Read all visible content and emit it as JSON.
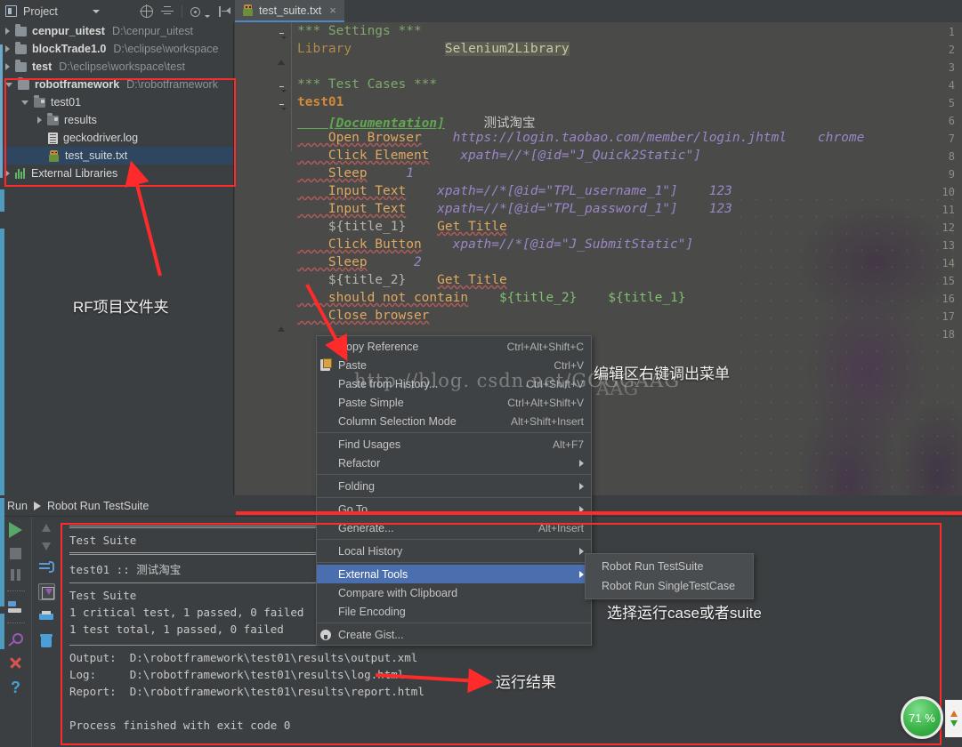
{
  "window": {
    "project_panel_title": "Project"
  },
  "toolbar": {
    "icons": [
      "locate-target-icon",
      "collapse-all-icon",
      "settings-gear-icon",
      "hide-panel-icon"
    ]
  },
  "tabs": [
    {
      "label": "test_suite.txt",
      "icon": "robot-file-icon",
      "close": "×",
      "active": true
    }
  ],
  "tree": {
    "items": [
      {
        "name": "cenpur_uitest",
        "path": "D:\\cenpur_uitest",
        "indent": 0,
        "arrow": "closed",
        "icon": "folder-icon",
        "bold": true
      },
      {
        "name": "blockTrade1.0",
        "path": "D:\\eclipse\\workspace",
        "indent": 0,
        "arrow": "closed",
        "icon": "folder-icon",
        "bold": true
      },
      {
        "name": "test",
        "path": "D:\\eclipse\\workspace\\test",
        "indent": 0,
        "arrow": "closed",
        "icon": "folder-icon",
        "bold": true
      },
      {
        "name": "robotframework",
        "path": "D:\\robotframework",
        "indent": 0,
        "arrow": "open",
        "icon": "folder-icon",
        "bold": true
      },
      {
        "name": "test01",
        "path": "",
        "indent": 1,
        "arrow": "open",
        "icon": "module-folder-icon",
        "bold": false
      },
      {
        "name": "results",
        "path": "",
        "indent": 2,
        "arrow": "closed",
        "icon": "module-folder-icon",
        "bold": false
      },
      {
        "name": "geckodriver.log",
        "path": "",
        "indent": 2,
        "arrow": "none",
        "icon": "log-file-icon",
        "bold": false
      },
      {
        "name": "test_suite.txt",
        "path": "",
        "indent": 2,
        "arrow": "none",
        "icon": "robot-file-icon",
        "bold": false,
        "selected": true
      },
      {
        "name": "External Libraries",
        "path": "",
        "indent": 0,
        "arrow": "closed",
        "icon": "libraries-icon",
        "bold": false
      }
    ]
  },
  "editor": {
    "lines": [
      {
        "n": 1,
        "fold": "minus",
        "segments": [
          {
            "t": "*** Settings ***",
            "c": "c-sec"
          }
        ]
      },
      {
        "n": 2,
        "fold": "up",
        "segments": [
          {
            "t": "Library",
            "c": "c-set"
          },
          {
            "t": "            ",
            "c": "c-plain"
          },
          {
            "t": "Selenium2Library",
            "c": "c-val"
          }
        ]
      },
      {
        "n": 3,
        "fold": "",
        "segments": []
      },
      {
        "n": 4,
        "fold": "minus",
        "segments": [
          {
            "t": "*** Test Cases ***",
            "c": "c-sec"
          }
        ]
      },
      {
        "n": 5,
        "fold": "minus",
        "segments": [
          {
            "t": "test01",
            "c": "c-case"
          }
        ]
      },
      {
        "n": 6,
        "fold": "",
        "segments": [
          {
            "t": "    [Documentation]",
            "c": "c-doc"
          },
          {
            "t": "     ",
            "c": "c-plain"
          },
          {
            "t": "测试淘宝",
            "c": "c-cn"
          }
        ]
      },
      {
        "n": 7,
        "fold": "",
        "segments": [
          {
            "t": "    Open Browser",
            "c": "c-kw"
          },
          {
            "t": "    ",
            "c": "c-plain"
          },
          {
            "t": "https://login.taobao.com/member/login.jhtml",
            "c": "c-arg"
          },
          {
            "t": "    ",
            "c": "c-plain"
          },
          {
            "t": "chrome",
            "c": "c-arg"
          }
        ]
      },
      {
        "n": 8,
        "fold": "",
        "segments": [
          {
            "t": "    Click Element",
            "c": "c-kw"
          },
          {
            "t": "    ",
            "c": "c-plain"
          },
          {
            "t": "xpath=//*[@id=\"J_Quick2Static\"]",
            "c": "c-arg"
          }
        ]
      },
      {
        "n": 9,
        "fold": "",
        "segments": [
          {
            "t": "    Sleep",
            "c": "c-kw"
          },
          {
            "t": "     ",
            "c": "c-plain"
          },
          {
            "t": "1",
            "c": "c-arg"
          }
        ]
      },
      {
        "n": 10,
        "fold": "",
        "segments": [
          {
            "t": "    Input Text",
            "c": "c-kw"
          },
          {
            "t": "    ",
            "c": "c-plain"
          },
          {
            "t": "xpath=//*[@id=\"TPL_username_1\"]",
            "c": "c-arg"
          },
          {
            "t": "    ",
            "c": "c-plain"
          },
          {
            "t": "123",
            "c": "c-arg"
          }
        ]
      },
      {
        "n": 11,
        "fold": "",
        "segments": [
          {
            "t": "    Input Text",
            "c": "c-kw"
          },
          {
            "t": "    ",
            "c": "c-plain"
          },
          {
            "t": "xpath=//*[@id=\"TPL_password_1\"]",
            "c": "c-arg"
          },
          {
            "t": "    ",
            "c": "c-plain"
          },
          {
            "t": "123",
            "c": "c-arg"
          }
        ]
      },
      {
        "n": 12,
        "fold": "",
        "segments": [
          {
            "t": "    ${title_1}",
            "c": "c-var"
          },
          {
            "t": "    ",
            "c": "c-plain"
          },
          {
            "t": "Get Title",
            "c": "c-kw"
          }
        ]
      },
      {
        "n": 13,
        "fold": "",
        "segments": [
          {
            "t": "    Click Button",
            "c": "c-kw"
          },
          {
            "t": "    ",
            "c": "c-plain"
          },
          {
            "t": "xpath=//*[@id=\"J_SubmitStatic\"]",
            "c": "c-arg"
          }
        ]
      },
      {
        "n": 14,
        "fold": "",
        "segments": [
          {
            "t": "    Sleep",
            "c": "c-kw"
          },
          {
            "t": "      ",
            "c": "c-plain"
          },
          {
            "t": "2",
            "c": "c-arg"
          }
        ]
      },
      {
        "n": 15,
        "fold": "",
        "segments": [
          {
            "t": "    ${title_2}",
            "c": "c-var"
          },
          {
            "t": "    ",
            "c": "c-plain"
          },
          {
            "t": "Get Title",
            "c": "c-kw"
          }
        ]
      },
      {
        "n": 16,
        "fold": "",
        "segments": [
          {
            "t": "    should not contain",
            "c": "c-kw"
          },
          {
            "t": "    ",
            "c": "c-plain"
          },
          {
            "t": "${title_2}",
            "c": "c-var2"
          },
          {
            "t": "    ",
            "c": "c-plain"
          },
          {
            "t": "${title_1}",
            "c": "c-var2"
          }
        ]
      },
      {
        "n": 17,
        "fold": "up",
        "segments": [
          {
            "t": "    Close browser",
            "c": "c-kw"
          }
        ]
      },
      {
        "n": 18,
        "fold": "",
        "segments": []
      }
    ]
  },
  "context_menu": {
    "items": [
      {
        "label": "Copy Reference",
        "shortcut": "Ctrl+Alt+Shift+C",
        "icon": "",
        "submenu": false
      },
      {
        "label": "Paste",
        "shortcut": "Ctrl+V",
        "icon": "paste-icon",
        "submenu": false
      },
      {
        "label": "Paste from History...",
        "shortcut": "Ctrl+Shift+V",
        "icon": "",
        "submenu": false
      },
      {
        "label": "Paste Simple",
        "shortcut": "Ctrl+Alt+Shift+V",
        "icon": "",
        "submenu": false
      },
      {
        "label": "Column Selection Mode",
        "shortcut": "Alt+Shift+Insert",
        "icon": "",
        "submenu": false
      },
      {
        "separator": true
      },
      {
        "label": "Find Usages",
        "shortcut": "Alt+F7",
        "icon": "",
        "submenu": false
      },
      {
        "label": "Refactor",
        "shortcut": "",
        "icon": "",
        "submenu": true
      },
      {
        "separator": true
      },
      {
        "label": "Folding",
        "shortcut": "",
        "icon": "",
        "submenu": true
      },
      {
        "separator": true
      },
      {
        "label": "Go To",
        "shortcut": "",
        "icon": "",
        "submenu": true
      },
      {
        "label": "Generate...",
        "shortcut": "Alt+Insert",
        "icon": "",
        "submenu": false
      },
      {
        "separator": true
      },
      {
        "label": "Local History",
        "shortcut": "",
        "icon": "",
        "submenu": true
      },
      {
        "separator": true
      },
      {
        "label": "External Tools",
        "shortcut": "",
        "icon": "",
        "submenu": true,
        "highlighted": true
      },
      {
        "label": "Compare with Clipboard",
        "shortcut": "",
        "icon": "",
        "submenu": false
      },
      {
        "label": "File Encoding",
        "shortcut": "",
        "icon": "",
        "submenu": false
      },
      {
        "separator": true
      },
      {
        "label": "Create Gist...",
        "shortcut": "",
        "icon": "github-icon",
        "submenu": false
      }
    ]
  },
  "submenu": {
    "items": [
      {
        "label": "Robot Run TestSuite"
      },
      {
        "label": "Robot Run SingleTestCase"
      }
    ]
  },
  "run_panel": {
    "header_title": "Run",
    "header_config": "Robot Run TestSuite",
    "toolbar_icons": [
      "run-icon",
      "stop-icon",
      "pause-icon",
      "rerun-icon",
      "pin-icon",
      "close-icon",
      "help-icon",
      "scroll-up-icon",
      "scroll-down-icon",
      "soft-wrap-icon",
      "scroll-to-end-icon",
      "print-icon",
      "clear-all-icon"
    ],
    "console": [
      "Test Suite",
      "test01 :: 测试淘宝",
      "Test Suite",
      "1 critical test, 1 passed, 0 failed",
      "1 test total, 1 passed, 0 failed",
      "Output:  D:\\robotframework\\test01\\results\\output.xml",
      "Log:     D:\\robotframework\\test01\\results\\log.html",
      "Report:  D:\\robotframework\\test01\\results\\report.html",
      "Process finished with exit code 0"
    ]
  },
  "annotations": {
    "project_folder": "RF项目文件夹",
    "editor_right_click": "编辑区右键调出菜单",
    "choose_run": "选择运行case或者suite",
    "run_result": "运行结果"
  },
  "watermark": {
    "text": "http://blog. csdn.net/GOGGAAG",
    "text2": "AAG"
  },
  "status": {
    "progress_label": "71 %"
  },
  "colors": {
    "accent_blue": "#4b6eaf",
    "annotation_red": "#ff2a2a",
    "selection_blue": "#2f4661",
    "progress_green": "#3cb44a",
    "editor_bg": "#4a4a48",
    "panel_bg": "#3c3f41"
  }
}
